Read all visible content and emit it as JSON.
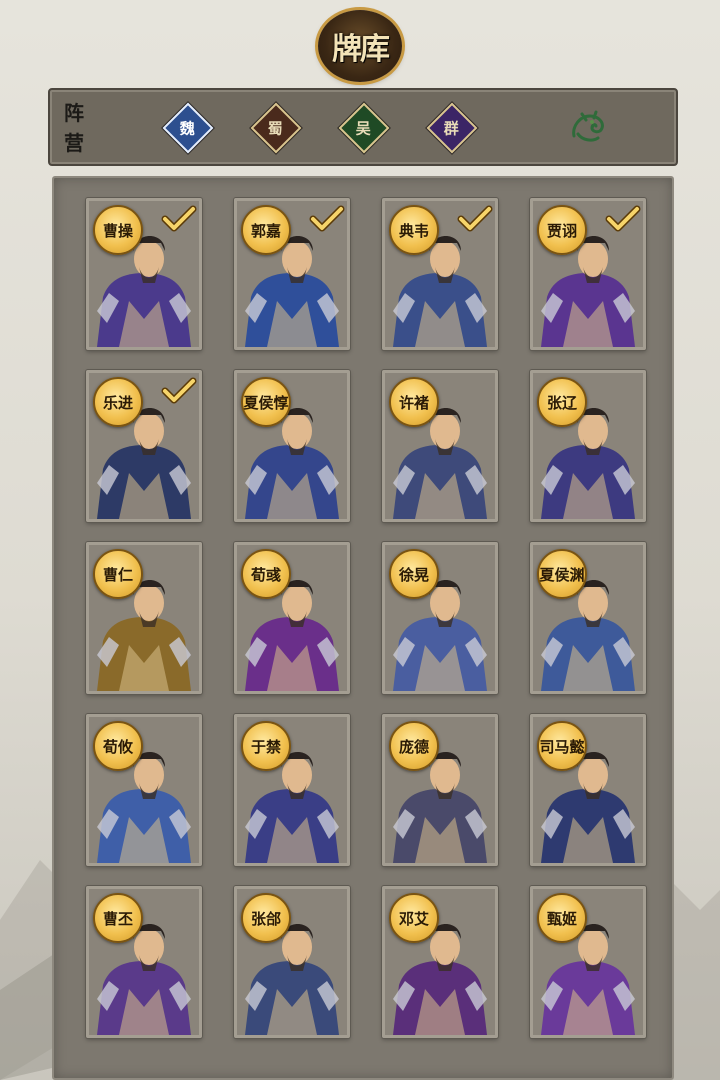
{
  "title": "牌库",
  "faction_filter": {
    "label_line1": "阵",
    "label_line2": "营",
    "factions": [
      {
        "label": "魏",
        "icon": "wei-faction-icon",
        "selected": true,
        "color": "#2d4f8f"
      },
      {
        "label": "蜀",
        "icon": "shu-faction-icon",
        "selected": false,
        "color": "#4a2a1c"
      },
      {
        "label": "吴",
        "icon": "wu-faction-icon",
        "selected": false,
        "color": "#1f4a25"
      },
      {
        "label": "群",
        "icon": "qun-faction-icon",
        "selected": false,
        "color": "#3b2566"
      },
      {
        "label": "",
        "icon": "dragon-icon",
        "selected": false,
        "color": "#2f6b3a"
      }
    ]
  },
  "cards": [
    {
      "name": "曹操",
      "owned": true,
      "tint": "#4b3a8c"
    },
    {
      "name": "郭嘉",
      "owned": true,
      "tint": "#2f4f9a"
    },
    {
      "name": "典韦",
      "owned": true,
      "tint": "#3a4f8a"
    },
    {
      "name": "贾诩",
      "owned": true,
      "tint": "#5a3590"
    },
    {
      "name": "乐进",
      "owned": true,
      "tint": "#2d3a66"
    },
    {
      "name": "夏侯惇",
      "owned": false,
      "tint": "#34468c"
    },
    {
      "name": "许褚",
      "owned": false,
      "tint": "#3e4a7a"
    },
    {
      "name": "张辽",
      "owned": false,
      "tint": "#3d3a80"
    },
    {
      "name": "曹仁",
      "owned": false,
      "tint": "#8a6a2a"
    },
    {
      "name": "荀彧",
      "owned": false,
      "tint": "#6a2f8a"
    },
    {
      "name": "徐晃",
      "owned": false,
      "tint": "#4a5ea0"
    },
    {
      "name": "夏侯渊",
      "owned": false,
      "tint": "#3e5a9a"
    },
    {
      "name": "荀攸",
      "owned": false,
      "tint": "#3f5fa8"
    },
    {
      "name": "于禁",
      "owned": false,
      "tint": "#3a3e86"
    },
    {
      "name": "庞德",
      "owned": false,
      "tint": "#4a4a6a"
    },
    {
      "name": "司马懿",
      "owned": false,
      "tint": "#2e3a70"
    },
    {
      "name": "曹丕",
      "owned": false,
      "tint": "#5a3a8a"
    },
    {
      "name": "张郃",
      "owned": false,
      "tint": "#3a4a7a"
    },
    {
      "name": "邓艾",
      "owned": false,
      "tint": "#5a2f7a"
    },
    {
      "name": "甄姬",
      "owned": false,
      "tint": "#6a3a9a"
    }
  ]
}
